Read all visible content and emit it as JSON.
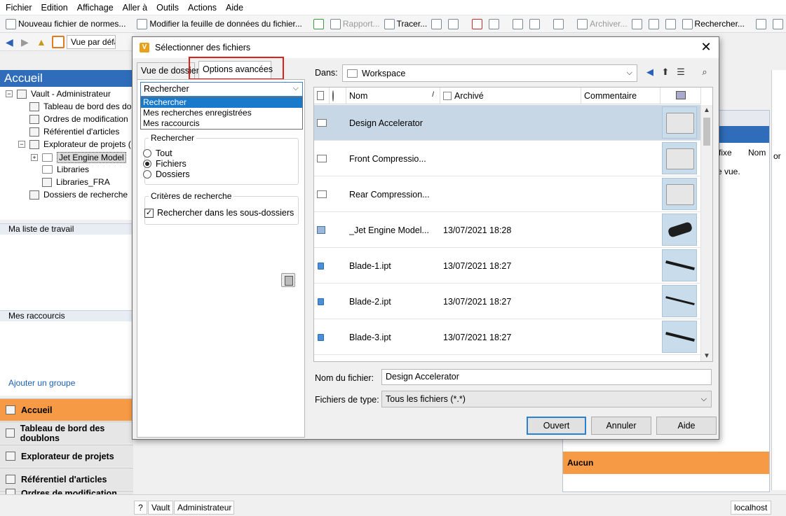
{
  "menu": [
    "Fichier",
    "Edition",
    "Affichage",
    "Aller à",
    "Outils",
    "Actions",
    "Aide"
  ],
  "toolbar": {
    "new_norm_file": "Nouveau fichier de normes...",
    "modify_data_sheet": "Modifier la feuille de données du fichier...",
    "report": "Rapport...",
    "trace": "Tracer...",
    "archive": "Archiver...",
    "search": "Rechercher..."
  },
  "view_combo": "Vue par défaut",
  "left_pane": {
    "title": "Accueil",
    "tree": [
      "Vault - Administrateur",
      "Tableau de bord des doublons",
      "Ordres de modification",
      "Référentiel d'articles",
      "Explorateur de projets (",
      "Jet Engine Model",
      "Libraries",
      "Libraries_FRA",
      "Dossiers de recherche"
    ],
    "worklist_header": "Ma liste de travail",
    "shortcuts_header": "Mes raccourcis",
    "add_group": "Ajouter un groupe",
    "nav_buttons": [
      "Accueil",
      "Tableau de bord des doublons",
      "Explorateur de projets",
      "Référentiel d'articles",
      "Ordres de modification"
    ]
  },
  "background_right": {
    "col_suffix": "fixe",
    "col_name": "Nom",
    "col_or": "or",
    "view_text": "e vue.",
    "aucun": "Aucun"
  },
  "statusbar": {
    "help": "?",
    "vault": "Vault",
    "user": "Administrateur",
    "host": "localhost"
  },
  "dialog": {
    "title": "Sélectionner des fichiers",
    "logo": "V",
    "tabs": [
      "Vue de dossier",
      "Options avancées"
    ],
    "search_combo": "Rechercher",
    "dropdown_items": [
      "Rechercher",
      "Mes recherches enregistrées",
      "Mes raccourcis"
    ],
    "search_group": {
      "legend": "Rechercher",
      "options": [
        "Tout",
        "Fichiers",
        "Dossiers"
      ],
      "selected_index": 1
    },
    "criteria_group": {
      "legend": "Critères de recherche",
      "subfolders_label": "Rechercher dans les sous-dossiers",
      "subfolders_checked": true
    },
    "in_label": "Dans:",
    "in_value": "Workspace",
    "columns": {
      "name": "Nom",
      "name_sort": "/",
      "archived": "Archivé",
      "comment": "Commentaire"
    },
    "rows": [
      {
        "name": "Design Accelerator",
        "date": "",
        "type": "folder"
      },
      {
        "name": "Front Compressio...",
        "date": "",
        "type": "folder"
      },
      {
        "name": "Rear Compression...",
        "date": "",
        "type": "folder"
      },
      {
        "name": "_Jet Engine Model...",
        "date": "13/07/2021 18:28",
        "type": "assembly"
      },
      {
        "name": "Blade-1.ipt",
        "date": "13/07/2021 18:27",
        "type": "part"
      },
      {
        "name": "Blade-2.ipt",
        "date": "13/07/2021 18:27",
        "type": "part"
      },
      {
        "name": "Blade-3.ipt",
        "date": "13/07/2021 18:27",
        "type": "part"
      }
    ],
    "filename_label": "Nom du fichier:",
    "filename_value": "Design Accelerator",
    "filetype_label": "Fichiers de type:",
    "filetype_value": "Tous les fichiers (*.*)",
    "ok_label": "Ouvert",
    "cancel_label": "Annuler",
    "help_label": "Aide",
    "close_glyph": "✕",
    "dropdown_glyph": "⌵"
  }
}
